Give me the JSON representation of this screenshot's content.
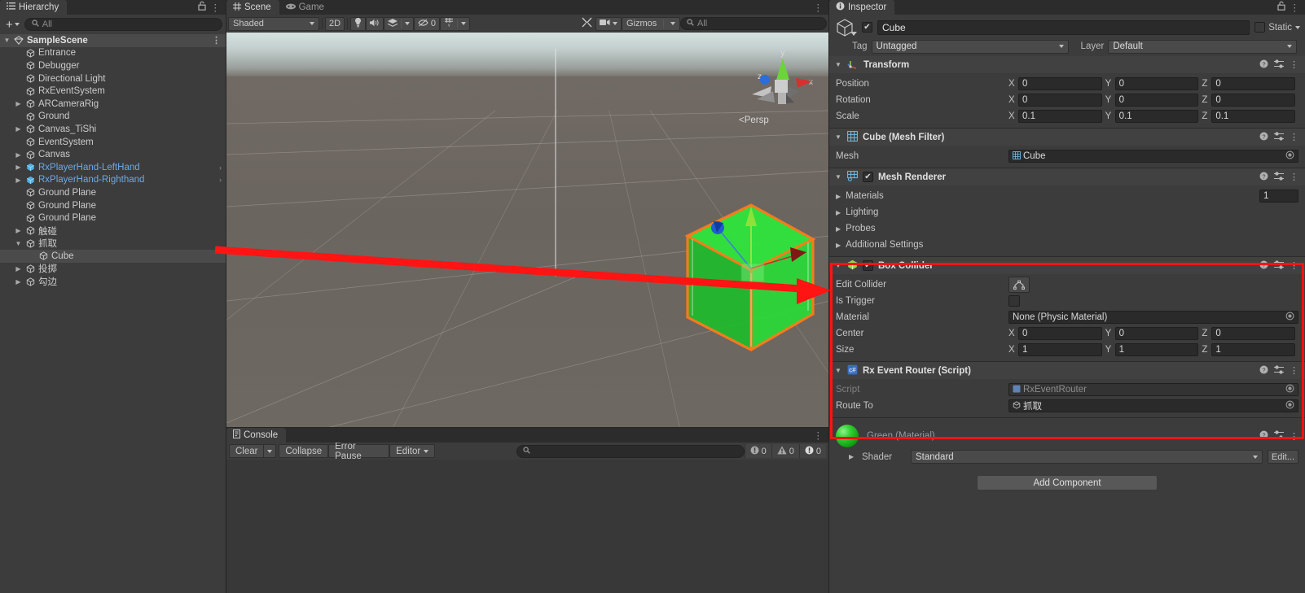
{
  "hierarchy": {
    "tab_label": "Hierarchy",
    "search_placeholder": "All",
    "add_label": "+",
    "items": [
      {
        "label": "SampleScene",
        "depth": 0,
        "type": "scene",
        "arrow": "down",
        "kebab": true
      },
      {
        "label": "Entrance",
        "depth": 1,
        "type": "go",
        "arrow": ""
      },
      {
        "label": "Debugger",
        "depth": 1,
        "type": "go",
        "arrow": ""
      },
      {
        "label": "Directional Light",
        "depth": 1,
        "type": "go",
        "arrow": ""
      },
      {
        "label": "RxEventSystem",
        "depth": 1,
        "type": "go",
        "arrow": ""
      },
      {
        "label": "ARCameraRig",
        "depth": 1,
        "type": "go",
        "arrow": "right"
      },
      {
        "label": "Ground",
        "depth": 1,
        "type": "go",
        "arrow": ""
      },
      {
        "label": "Canvas_TiShi",
        "depth": 1,
        "type": "go",
        "arrow": "right"
      },
      {
        "label": "EventSystem",
        "depth": 1,
        "type": "go",
        "arrow": ""
      },
      {
        "label": "Canvas",
        "depth": 1,
        "type": "go",
        "arrow": "right"
      },
      {
        "label": "RxPlayerHand-LeftHand",
        "depth": 1,
        "type": "prefab",
        "arrow": "right",
        "tail": true
      },
      {
        "label": "RxPlayerHand-Righthand",
        "depth": 1,
        "type": "prefab",
        "arrow": "right",
        "tail": true
      },
      {
        "label": "Ground Plane",
        "depth": 1,
        "type": "go",
        "arrow": ""
      },
      {
        "label": "Ground Plane",
        "depth": 1,
        "type": "go",
        "arrow": ""
      },
      {
        "label": "Ground Plane",
        "depth": 1,
        "type": "go",
        "arrow": ""
      },
      {
        "label": "触碰",
        "depth": 1,
        "type": "go",
        "arrow": "right"
      },
      {
        "label": "抓取",
        "depth": 1,
        "type": "go",
        "arrow": "down"
      },
      {
        "label": "Cube",
        "depth": 2,
        "type": "go",
        "arrow": "",
        "selected": true
      },
      {
        "label": "投掷",
        "depth": 1,
        "type": "go",
        "arrow": "right"
      },
      {
        "label": "勾边",
        "depth": 1,
        "type": "go",
        "arrow": "right"
      }
    ]
  },
  "scene": {
    "tabs": [
      {
        "label": "Scene",
        "icon": "grid-icon",
        "active": true
      },
      {
        "label": "Game",
        "icon": "gamepad-icon",
        "active": false
      }
    ],
    "toolbar": {
      "draw_mode": "Shaded",
      "mode_2d": "2D",
      "lighting_icon": "lightbulb-icon",
      "audio_icon": "speaker-icon",
      "fx_icon": "effects-icon",
      "hidden_count": "0",
      "grid_icon": "grid-visibility-icon",
      "tools_icon": "scene-tools-icon",
      "camera_icon": "camera-icon",
      "gizmos_label": "Gizmos",
      "search_placeholder": "All"
    },
    "gizmo": {
      "x_label": "x",
      "y_label": "y",
      "z_label": "z",
      "perspective_label": "Persp",
      "perspective_prefix": "<"
    }
  },
  "console": {
    "tab_label": "Console",
    "clear_label": "Clear",
    "collapse_label": "Collapse",
    "error_pause_label": "Error Pause",
    "editor_label": "Editor",
    "search_placeholder": "",
    "log_count": "0",
    "warning_count": "0",
    "error_count": "0"
  },
  "inspector": {
    "tab_label": "Inspector",
    "object": {
      "enabled": true,
      "name": "Cube",
      "static_label": "Static",
      "tag_label": "Tag",
      "tag_value": "Untagged",
      "layer_label": "Layer",
      "layer_value": "Default"
    },
    "components": [
      {
        "name": "Transform",
        "icon": "transform-icon",
        "has_checkbox": false,
        "rows": [
          {
            "label": "Position",
            "kind": "vec3",
            "x": "0",
            "y": "0",
            "z": "0"
          },
          {
            "label": "Rotation",
            "kind": "vec3",
            "x": "0",
            "y": "0",
            "z": "0"
          },
          {
            "label": "Scale",
            "kind": "vec3",
            "x": "0.1",
            "y": "0.1",
            "z": "0.1"
          }
        ]
      },
      {
        "name": "Cube (Mesh Filter)",
        "icon": "mesh-filter-icon",
        "has_checkbox": false,
        "rows": [
          {
            "label": "Mesh",
            "kind": "object",
            "value": "Cube"
          }
        ]
      },
      {
        "name": "Mesh Renderer",
        "icon": "mesh-renderer-icon",
        "has_checkbox": true,
        "rows": [
          {
            "label": "Materials",
            "kind": "foldout",
            "value": "1"
          },
          {
            "label": "Lighting",
            "kind": "foldout"
          },
          {
            "label": "Probes",
            "kind": "foldout"
          },
          {
            "label": "Additional Settings",
            "kind": "foldout"
          }
        ]
      },
      {
        "name": "Box Collider",
        "icon": "box-collider-icon",
        "has_checkbox": true,
        "highlighted": true,
        "rows": [
          {
            "label": "Edit Collider",
            "kind": "editbtn"
          },
          {
            "label": "Is Trigger",
            "kind": "checkbox"
          },
          {
            "label": "Material",
            "kind": "object",
            "value": "None (Physic Material)"
          },
          {
            "label": "Center",
            "kind": "vec3",
            "x": "0",
            "y": "0",
            "z": "0"
          },
          {
            "label": "Size",
            "kind": "vec3",
            "x": "1",
            "y": "1",
            "z": "1"
          }
        ]
      },
      {
        "name": "Rx Event Router (Script)",
        "icon": "csharp-script-icon",
        "has_checkbox": false,
        "highlighted": true,
        "rows": [
          {
            "label": "Script",
            "kind": "object",
            "value": "RxEventRouter",
            "dim": true
          },
          {
            "label": "Route To",
            "kind": "object",
            "value": "抓取"
          }
        ]
      }
    ],
    "material": {
      "title": "Green (Material)",
      "shader_label": "Shader",
      "shader_value": "Standard",
      "edit_label": "Edit..."
    },
    "add_component_label": "Add Component"
  },
  "annotation": {
    "highlight_color": "#ff1414",
    "arrow_name": "red-pointer-arrow"
  }
}
